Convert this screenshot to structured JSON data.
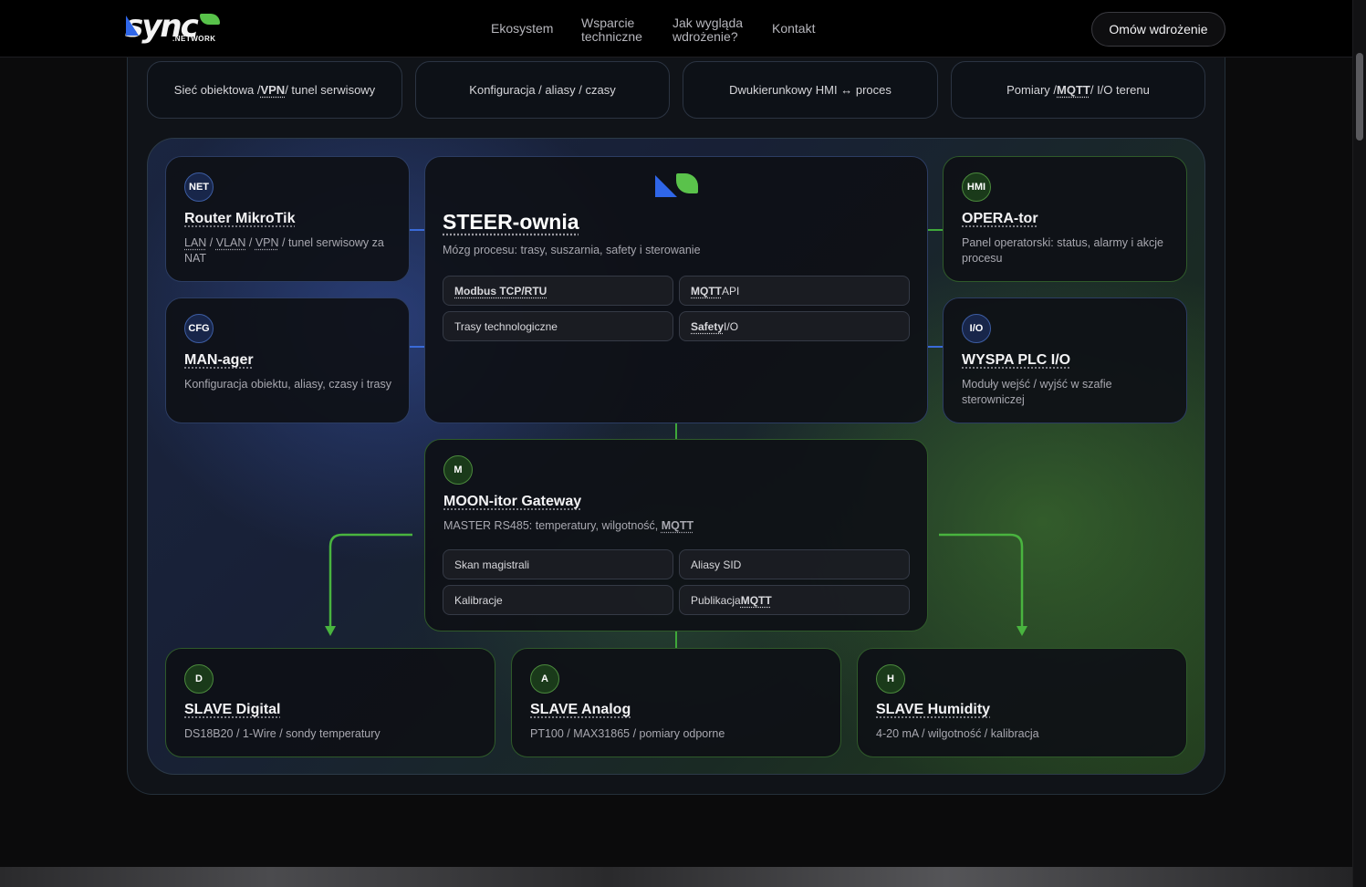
{
  "nav": {
    "logo_text": "sync",
    "logo_sub": ".NETWORK",
    "links": [
      "Ekosystem",
      "Wsparcie\ntechniczne",
      "Jak wygląda\nwdrożenie?",
      "Kontakt"
    ],
    "link_0": "Ekosystem",
    "link_1a": "Wsparcie",
    "link_1b": "techniczne",
    "link_2a": "Jak wygląda",
    "link_2b": "wdrożenie?",
    "link_3": "Kontakt",
    "cta": "Omów wdrożenie"
  },
  "pills": [
    {
      "pre": "Sieć obiektowa /",
      "em": "VPN",
      "post": "/ tunel serwisowy"
    },
    {
      "pre": "Konfiguracja / aliasy / czasy",
      "em": "",
      "post": ""
    },
    {
      "pre": "Dwukierunkowy HMI ↔ proces",
      "em": "",
      "post": ""
    },
    {
      "pre": "Pomiary /",
      "em": "MQTT",
      "post": "/ I/O terenu"
    }
  ],
  "cards": {
    "router": {
      "badge": "NET",
      "title": "Router MikroTik",
      "desc_u1": "LAN",
      "sep1": " / ",
      "desc_u2": "VLAN",
      "sep2": " / ",
      "desc_u3": "VPN",
      "desc_rest": " / tunel serwisowy za NAT"
    },
    "manager": {
      "badge": "CFG",
      "title": "MAN-ager",
      "desc": "Konfiguracja obiektu, aliasy, czasy i trasy"
    },
    "opera": {
      "badge": "HMI",
      "title": "OPERA-tor",
      "desc": "Panel operatorski: status, alarmy i akcje procesu"
    },
    "wyspa": {
      "badge": "I/O",
      "title": "WYSPA PLC I/O",
      "desc": "Moduły wejść / wyjść w szafie sterowniczej"
    },
    "steer": {
      "title": "STEER-ownia",
      "desc": "Mózg procesu: trasy, suszarnia, safety i sterowanie",
      "chip0": "Modbus TCP/RTU",
      "chip1_u": "MQTT",
      "chip1_rest": " API",
      "chip2": "Trasy technologiczne",
      "chip3_u": "Safety",
      "chip3_rest": " I/O"
    },
    "moon": {
      "badge": "M",
      "title": "MOON-itor Gateway",
      "desc_pre": "MASTER RS485: temperatury, wilgotność, ",
      "desc_u": "MQTT",
      "chip0": "Skan magistrali",
      "chip1": "Aliasy SID",
      "chip2": "Kalibracje",
      "chip3_pre": "Publikacja ",
      "chip3_u": "MQTT"
    },
    "digital": {
      "badge": "D",
      "title": "SLAVE Digital",
      "desc": "DS18B20 / 1-Wire / sondy temperatury"
    },
    "analog": {
      "badge": "A",
      "title": "SLAVE Analog",
      "desc": "PT100 / MAX31865 / pomiary odporne"
    },
    "humidity": {
      "badge": "H",
      "title": "SLAVE Humidity",
      "desc": "4-20 mA / wilgotność / kalibracja"
    }
  },
  "colors": {
    "blue": "#3a6ad8",
    "green": "#3fa83a",
    "bg": "#0b0b0c"
  }
}
